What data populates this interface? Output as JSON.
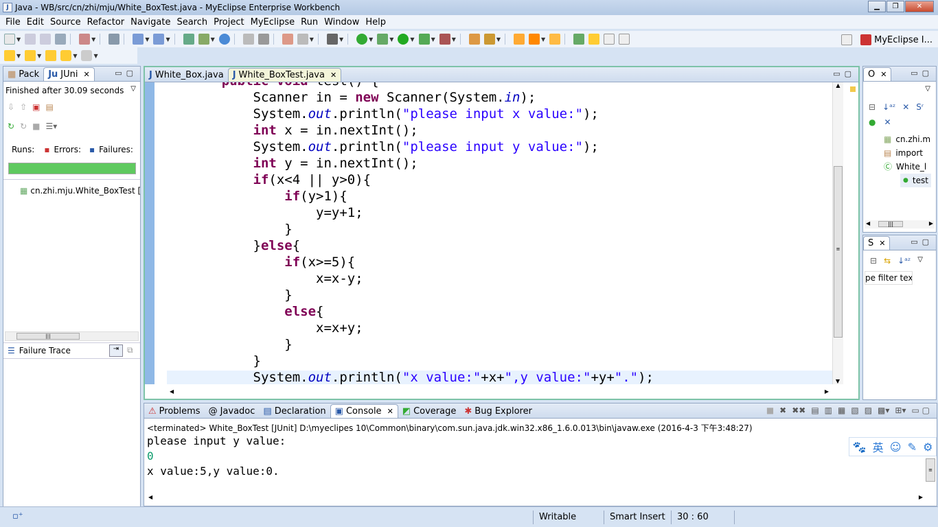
{
  "window": {
    "title": "Java - WB/src/cn/zhi/mju/White_BoxTest.java - MyEclipse Enterprise Workbench"
  },
  "menu": [
    "File",
    "Edit",
    "Source",
    "Refactor",
    "Navigate",
    "Search",
    "Project",
    "MyEclipse",
    "Run",
    "Window",
    "Help"
  ],
  "perspective": {
    "label": "MyEclipse I..."
  },
  "junit": {
    "tabs": [
      "Pack",
      "JUni"
    ],
    "status": "Finished after 30.09 seconds",
    "runs_label": "Runs:",
    "errors_label": "Errors:",
    "failures_label": "Failures:",
    "progress": 1.0,
    "progress_color": "#5fc95f",
    "test_item": "cn.zhi.mju.White_BoxTest [",
    "failure_trace": "Failure Trace"
  },
  "editor": {
    "tabs": [
      "White_Box.java",
      "White_BoxTest.java"
    ],
    "lines": [
      "    public void test() {",
      "        Scanner in = new Scanner(System.in);",
      "        System.out.println(\"please input x value:\");",
      "        int x = in.nextInt();",
      "        System.out.println(\"please input y value:\");",
      "        int y = in.nextInt();",
      "        if(x<4 || y>0){",
      "            if(y>1){",
      "                y=y+1;",
      "            }",
      "        }else{",
      "            if(x>=5){",
      "                x=x-y;",
      "            }",
      "            else{",
      "                x=x+y;",
      "            }",
      "        }",
      "        System.out.println(\"x value:\"+x+\",y value:\"+y+\".\");"
    ]
  },
  "outline": {
    "tab": "O",
    "items": [
      "cn.zhi.m",
      "import",
      "White_l",
      "test"
    ]
  },
  "second_right": {
    "tab": "S",
    "filter": "pe filter text"
  },
  "console": {
    "tabs": [
      "Problems",
      "Javadoc",
      "Declaration",
      "Console",
      "Coverage",
      "Bug Explorer"
    ],
    "header": "<terminated> White_BoxTest [JUnit] D:\\myeclipes 10\\Common\\binary\\com.sun.java.jdk.win32.x86_1.6.0.013\\bin\\javaw.exe (2016-4-3 下午3:48:27)",
    "line1": "please input y value:",
    "line2": "0",
    "line3": "x value:5,y value:0."
  },
  "ime": {
    "items": [
      "🐾",
      "英",
      "☺",
      "✎",
      "⚙"
    ]
  },
  "status": {
    "writable": "Writable",
    "insert": "Smart Insert",
    "position": "30 : 60"
  }
}
